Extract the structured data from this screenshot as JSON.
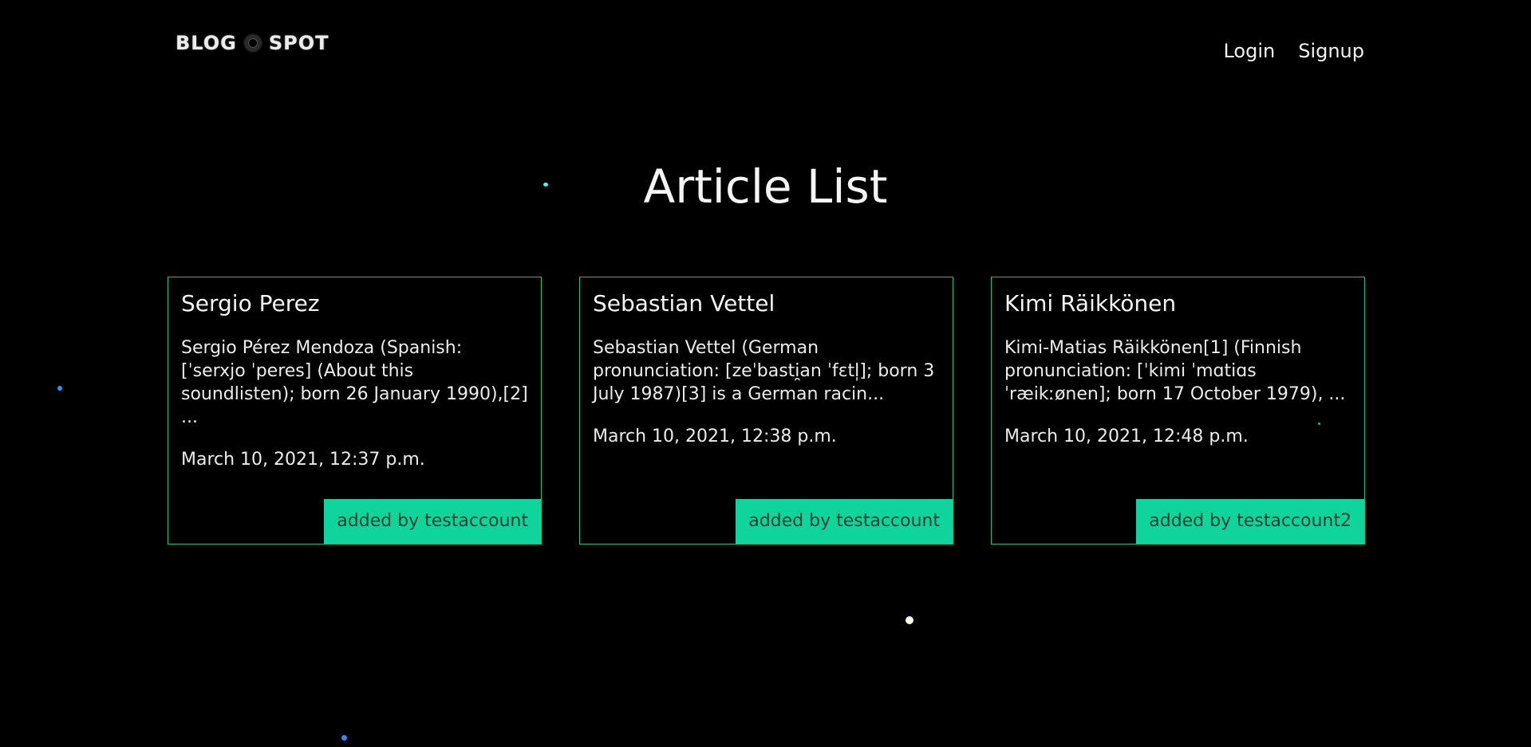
{
  "header": {
    "logo_left": "BLOG",
    "logo_right": "SPOT",
    "nav": {
      "login": "Login",
      "signup": "Signup"
    }
  },
  "main": {
    "title": "Article List",
    "articles": [
      {
        "title": "Sergio Perez",
        "excerpt": "Sergio Pérez Mendoza (Spanish: [ˈserxjo ˈperes] (About this soundlisten); born 26 January 1990),[2] ...",
        "date": "March 10, 2021, 12:37 p.m.",
        "author": "added by testaccount"
      },
      {
        "title": "Sebastian Vettel",
        "excerpt": "Sebastian Vettel (German pronunciation: [zeˈbasti̯an ˈfɛtl̩]; born 3 July 1987)[3] is a German racin...",
        "date": "March 10, 2021, 12:38 p.m.",
        "author": "added by testaccount"
      },
      {
        "title": "Kimi Räikkönen",
        "excerpt": "Kimi-Matias Räikkönen[1] (Finnish pronunciation: [ˈkimi ˈmɑtiɑs ˈræikːønen]; born 17 October 1979), ...",
        "date": "March 10, 2021, 12:48 p.m.",
        "author": "added by testaccount2"
      }
    ]
  },
  "colors": {
    "background": "#000000",
    "accent": "#0fd49b",
    "card_border": "#1fb98a"
  }
}
